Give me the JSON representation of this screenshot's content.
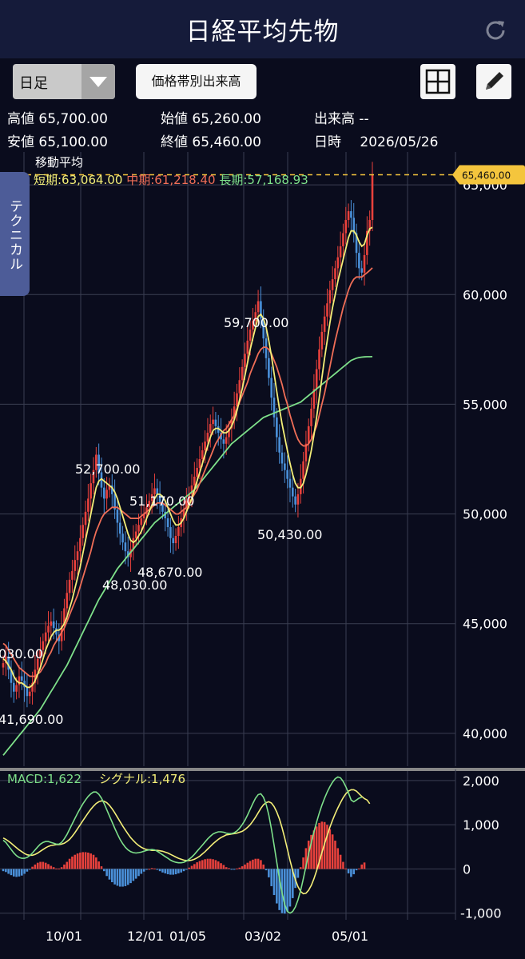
{
  "app": {
    "title": "日経平均先物"
  },
  "toolbar": {
    "period": "日足",
    "volume_button": "価格帯別出来高"
  },
  "stats": {
    "high_label": "高値",
    "high": "65,700.00",
    "open_label": "始値",
    "open": "65,260.00",
    "volume_label": "出来高",
    "volume": "--",
    "low_label": "安値",
    "low": "65,100.00",
    "close_label": "終値",
    "close": "65,460.00",
    "date_label": "日時",
    "date": "2026/05/26"
  },
  "ma": {
    "heading": "移動平均",
    "short": "短期:63,064.00",
    "mid": "中期:61,218.40",
    "long": "長期:57,168.93"
  },
  "side_tab": "テクニカル",
  "macd_legend": {
    "macd": "MACD:1,622",
    "signal": "シグナル:1,476"
  },
  "colors": {
    "short": "#f3ee78",
    "mid": "#f06e57",
    "long": "#7ee08a",
    "up": "#e8413c",
    "down": "#4a90d9",
    "price_tag": "#f4c53d"
  },
  "icons": {
    "refresh": "refresh-icon",
    "grid": "grid-icon",
    "edit": "pencil-icon",
    "dropdown": "chevron-down-icon"
  },
  "chart_data": {
    "type": "candlestick",
    "y_axis": {
      "ticks": [
        40000,
        45000,
        50000,
        55000,
        60000,
        65000
      ],
      "tick_labels": [
        "40,000",
        "45,000",
        "50,000",
        "55,000",
        "60,000",
        "65,000"
      ],
      "ylim": [
        38500,
        66500
      ]
    },
    "x_axis": {
      "tick_labels": [
        "10/01",
        "12/01",
        "01/05",
        "03/02",
        "05/01"
      ]
    },
    "last_price_label": "65,460.00",
    "annotations": [
      "59,700.00",
      "52,700.00",
      "51,170.00",
      "48,670.00",
      "48,030.00",
      "50,430.00",
      "030.00",
      "41,690.00"
    ],
    "close_series": [
      43200,
      43500,
      42900,
      42300,
      41900,
      42200,
      42600,
      42400,
      42100,
      41700,
      41900,
      42300,
      42900,
      43400,
      43800,
      44200,
      44600,
      44900,
      45100,
      44800,
      44500,
      44200,
      44900,
      45700,
      46400,
      47000,
      47400,
      47900,
      48300,
      48900,
      49500,
      50100,
      50700,
      51400,
      52000,
      52700,
      51900,
      51200,
      50700,
      51100,
      51300,
      50900,
      50200,
      49600,
      49100,
      48700,
      48300,
      48030,
      48400,
      48900,
      49200,
      49500,
      49800,
      50000,
      50300,
      50600,
      50900,
      51170,
      50900,
      50500,
      50100,
      49800,
      49400,
      48900,
      48670,
      49000,
      49400,
      49800,
      50200,
      50600,
      50900,
      51300,
      51700,
      52100,
      52500,
      52900,
      53300,
      53700,
      54100,
      54300,
      54000,
      53700,
      53400,
      53200,
      53500,
      53900,
      54300,
      54900,
      55500,
      56100,
      56700,
      57300,
      57900,
      58400,
      58800,
      59200,
      59700,
      58900,
      58000,
      57100,
      56200,
      55300,
      54400,
      53500,
      52800,
      52300,
      52000,
      51600,
      51200,
      50800,
      50430,
      50900,
      51600,
      52400,
      53200,
      54000,
      54800,
      55700,
      56600,
      57500,
      58300,
      59000,
      59600,
      60200,
      60700,
      61200,
      61700,
      62200,
      62800,
      63400,
      63800,
      63500,
      62800,
      61900,
      61200,
      61000,
      61800,
      62900,
      63400,
      65460
    ],
    "ma_short": [
      43400,
      43300,
      43100,
      42900,
      42600,
      42400,
      42300,
      42300,
      42200,
      42100,
      42100,
      42200,
      42400,
      42700,
      43000,
      43400,
      43800,
      44100,
      44400,
      44600,
      44700,
      44700,
      44800,
      45000,
      45300,
      45700,
      46100,
      46600,
      47100,
      47600,
      48200,
      48800,
      49400,
      50000,
      50600,
      51200,
      51500,
      51600,
      51500,
      51400,
      51300,
      51200,
      51000,
      50700,
      50300,
      49900,
      49500,
      49100,
      48800,
      48700,
      48800,
      49000,
      49200,
      49500,
      49800,
      50100,
      50400,
      50700,
      50900,
      50900,
      50800,
      50600,
      50300,
      50000,
      49700,
      49500,
      49500,
      49600,
      49800,
      50100,
      50400,
      50700,
      51100,
      51500,
      51900,
      52300,
      52700,
      53100,
      53500,
      53800,
      53900,
      53900,
      53800,
      53700,
      53700,
      53800,
      54000,
      54300,
      54700,
      55200,
      55700,
      56300,
      56900,
      57500,
      58000,
      58500,
      59000,
      59100,
      58900,
      58500,
      57900,
      57200,
      56400,
      55600,
      54800,
      54100,
      53500,
      52900,
      52300,
      51800,
      51400,
      51200,
      51200,
      51400,
      51800,
      52300,
      52900,
      53600,
      54400,
      55300,
      56200,
      57100,
      57900,
      58700,
      59400,
      60000,
      60600,
      61100,
      61600,
      62100,
      62600,
      62900,
      62900,
      62700,
      62400,
      62200,
      62300,
      62700,
      63000,
      63064
    ],
    "ma_mid": [
      44100,
      44000,
      43800,
      43600,
      43400,
      43200,
      43000,
      42900,
      42800,
      42700,
      42600,
      42600,
      42600,
      42700,
      42800,
      43000,
      43200,
      43500,
      43700,
      44000,
      44200,
      44400,
      44600,
      44800,
      45100,
      45400,
      45700,
      46000,
      46300,
      46700,
      47100,
      47500,
      47900,
      48300,
      48800,
      49200,
      49500,
      49800,
      50000,
      50100,
      50200,
      50300,
      50300,
      50300,
      50200,
      50100,
      50000,
      49900,
      49800,
      49800,
      49800,
      49800,
      49900,
      50000,
      50100,
      50200,
      50300,
      50400,
      50500,
      50500,
      50500,
      50400,
      50300,
      50200,
      50100,
      50000,
      50000,
      50100,
      50200,
      50300,
      50500,
      50700,
      50900,
      51100,
      51400,
      51700,
      52000,
      52300,
      52600,
      52900,
      53200,
      53400,
      53600,
      53800,
      53900,
      54100,
      54300,
      54500,
      54800,
      55100,
      55400,
      55700,
      56000,
      56400,
      56700,
      57000,
      57300,
      57500,
      57600,
      57600,
      57500,
      57300,
      57000,
      56700,
      56300,
      55900,
      55400,
      55000,
      54500,
      54100,
      53700,
      53400,
      53200,
      53100,
      53100,
      53200,
      53400,
      53700,
      54000,
      54500,
      55000,
      55500,
      56100,
      56700,
      57300,
      57900,
      58400,
      58900,
      59400,
      59800,
      60200,
      60500,
      60700,
      60800,
      60800,
      60800,
      60900,
      61000,
      61100,
      61218
    ],
    "ma_long": [
      39000,
      39150,
      39300,
      39450,
      39600,
      39750,
      39900,
      40050,
      40200,
      40350,
      40500,
      40650,
      40800,
      40950,
      41100,
      41300,
      41500,
      41700,
      41900,
      42100,
      42300,
      42500,
      42700,
      42900,
      43100,
      43350,
      43600,
      43850,
      44100,
      44350,
      44600,
      44850,
      45100,
      45350,
      45600,
      45850,
      46100,
      46300,
      46500,
      46700,
      46900,
      47100,
      47300,
      47500,
      47650,
      47800,
      47950,
      48100,
      48250,
      48400,
      48550,
      48700,
      48850,
      49000,
      49150,
      49300,
      49450,
      49600,
      49700,
      49800,
      49900,
      50000,
      50100,
      50200,
      50300,
      50400,
      50500,
      50600,
      50700,
      50800,
      50900,
      51000,
      51100,
      51250,
      51400,
      51550,
      51700,
      51850,
      52000,
      52150,
      52300,
      52450,
      52600,
      52750,
      52900,
      53050,
      53200,
      53300,
      53400,
      53500,
      53600,
      53700,
      53800,
      53900,
      54000,
      54100,
      54200,
      54300,
      54400,
      54450,
      54500,
      54550,
      54600,
      54650,
      54700,
      54750,
      54800,
      54850,
      54900,
      54950,
      55000,
      55050,
      55100,
      55200,
      55300,
      55400,
      55500,
      55600,
      55700,
      55800,
      55900,
      56000,
      56100,
      56200,
      56300,
      56400,
      56500,
      56600,
      56700,
      56800,
      56900,
      57000,
      57050,
      57100,
      57130,
      57150,
      57160,
      57165,
      57168,
      57168.93
    ],
    "macd": {
      "ylim": [
        -1150,
        2250
      ],
      "ticks": [
        -1000,
        0,
        1000,
        2000
      ],
      "tick_labels": [
        "-1,000",
        "0",
        "1,000",
        "2,000"
      ],
      "macd_series": [
        650,
        600,
        520,
        440,
        360,
        300,
        260,
        240,
        240,
        260,
        300,
        360,
        430,
        500,
        560,
        600,
        620,
        620,
        600,
        580,
        560,
        560,
        600,
        680,
        780,
        900,
        1020,
        1140,
        1260,
        1370,
        1470,
        1560,
        1640,
        1700,
        1740,
        1740,
        1690,
        1600,
        1480,
        1340,
        1200,
        1060,
        920,
        790,
        670,
        570,
        490,
        430,
        390,
        370,
        360,
        370,
        380,
        400,
        420,
        430,
        440,
        430,
        400,
        360,
        320,
        280,
        240,
        200,
        170,
        150,
        140,
        140,
        150,
        180,
        220,
        270,
        330,
        400,
        470,
        540,
        610,
        680,
        740,
        790,
        820,
        840,
        840,
        830,
        810,
        800,
        800,
        820,
        860,
        920,
        1000,
        1100,
        1220,
        1350,
        1480,
        1600,
        1680,
        1700,
        1620,
        1460,
        1220,
        900,
        540,
        160,
        -220,
        -540,
        -800,
        -960,
        -1000,
        -960,
        -860,
        -700,
        -480,
        -220,
        60,
        340,
        600,
        840,
        1060,
        1260,
        1440,
        1600,
        1740,
        1860,
        1960,
        2040,
        2080,
        2060,
        1980,
        1860,
        1720,
        1560,
        1520,
        1560,
        1600,
        1622
      ],
      "signal_series": [
        700,
        670,
        630,
        580,
        530,
        480,
        430,
        390,
        350,
        320,
        310,
        310,
        330,
        360,
        400,
        440,
        480,
        510,
        530,
        540,
        550,
        550,
        560,
        580,
        620,
        670,
        740,
        820,
        910,
        1000,
        1090,
        1180,
        1270,
        1350,
        1420,
        1480,
        1520,
        1540,
        1530,
        1500,
        1440,
        1360,
        1270,
        1170,
        1070,
        970,
        880,
        790,
        710,
        640,
        580,
        530,
        490,
        460,
        440,
        430,
        420,
        420,
        420,
        410,
        400,
        380,
        360,
        330,
        300,
        270,
        240,
        220,
        200,
        190,
        190,
        200,
        220,
        250,
        290,
        340,
        390,
        450,
        510,
        570,
        620,
        670,
        710,
        740,
        770,
        780,
        790,
        800,
        810,
        830,
        850,
        890,
        940,
        1000,
        1080,
        1170,
        1270,
        1370,
        1450,
        1500,
        1520,
        1490,
        1410,
        1290,
        1130,
        930,
        700,
        450,
        190,
        -40,
        -240,
        -400,
        -510,
        -560,
        -550,
        -480,
        -370,
        -220,
        -40,
        160,
        370,
        570,
        760,
        940,
        1100,
        1250,
        1380,
        1500,
        1610,
        1700,
        1760,
        1790,
        1790,
        1760,
        1700,
        1640,
        1590,
        1560,
        1476
      ],
      "hist_series": [
        -50,
        -70,
        -110,
        -140,
        -170,
        -180,
        -170,
        -150,
        -110,
        -60,
        -10,
        50,
        100,
        140,
        160,
        160,
        140,
        110,
        70,
        40,
        10,
        10,
        40,
        100,
        160,
        230,
        280,
        320,
        350,
        370,
        380,
        380,
        370,
        350,
        320,
        260,
        170,
        60,
        -50,
        -160,
        -240,
        -300,
        -350,
        -380,
        -400,
        -400,
        -390,
        -360,
        -320,
        -270,
        -220,
        -160,
        -110,
        -60,
        -20,
        0,
        20,
        10,
        -20,
        -50,
        -80,
        -100,
        -120,
        -130,
        -130,
        -120,
        -100,
        -80,
        -50,
        -10,
        30,
        70,
        110,
        150,
        180,
        200,
        220,
        230,
        230,
        220,
        200,
        170,
        130,
        90,
        40,
        20,
        -10,
        -10,
        10,
        30,
        60,
        100,
        140,
        180,
        210,
        230,
        230,
        200,
        100,
        -30,
        -190,
        -390,
        -590,
        -780,
        -930,
        -1000,
        -1010,
        -960,
        -850,
        -660,
        -430,
        -200,
        40,
        260,
        470,
        640,
        770,
        870,
        960,
        1040,
        1070,
        1060,
        1000,
        900,
        780,
        640,
        470,
        320,
        160,
        10,
        -100,
        -180,
        -120,
        -30,
        10,
        100,
        146
      ]
    }
  }
}
